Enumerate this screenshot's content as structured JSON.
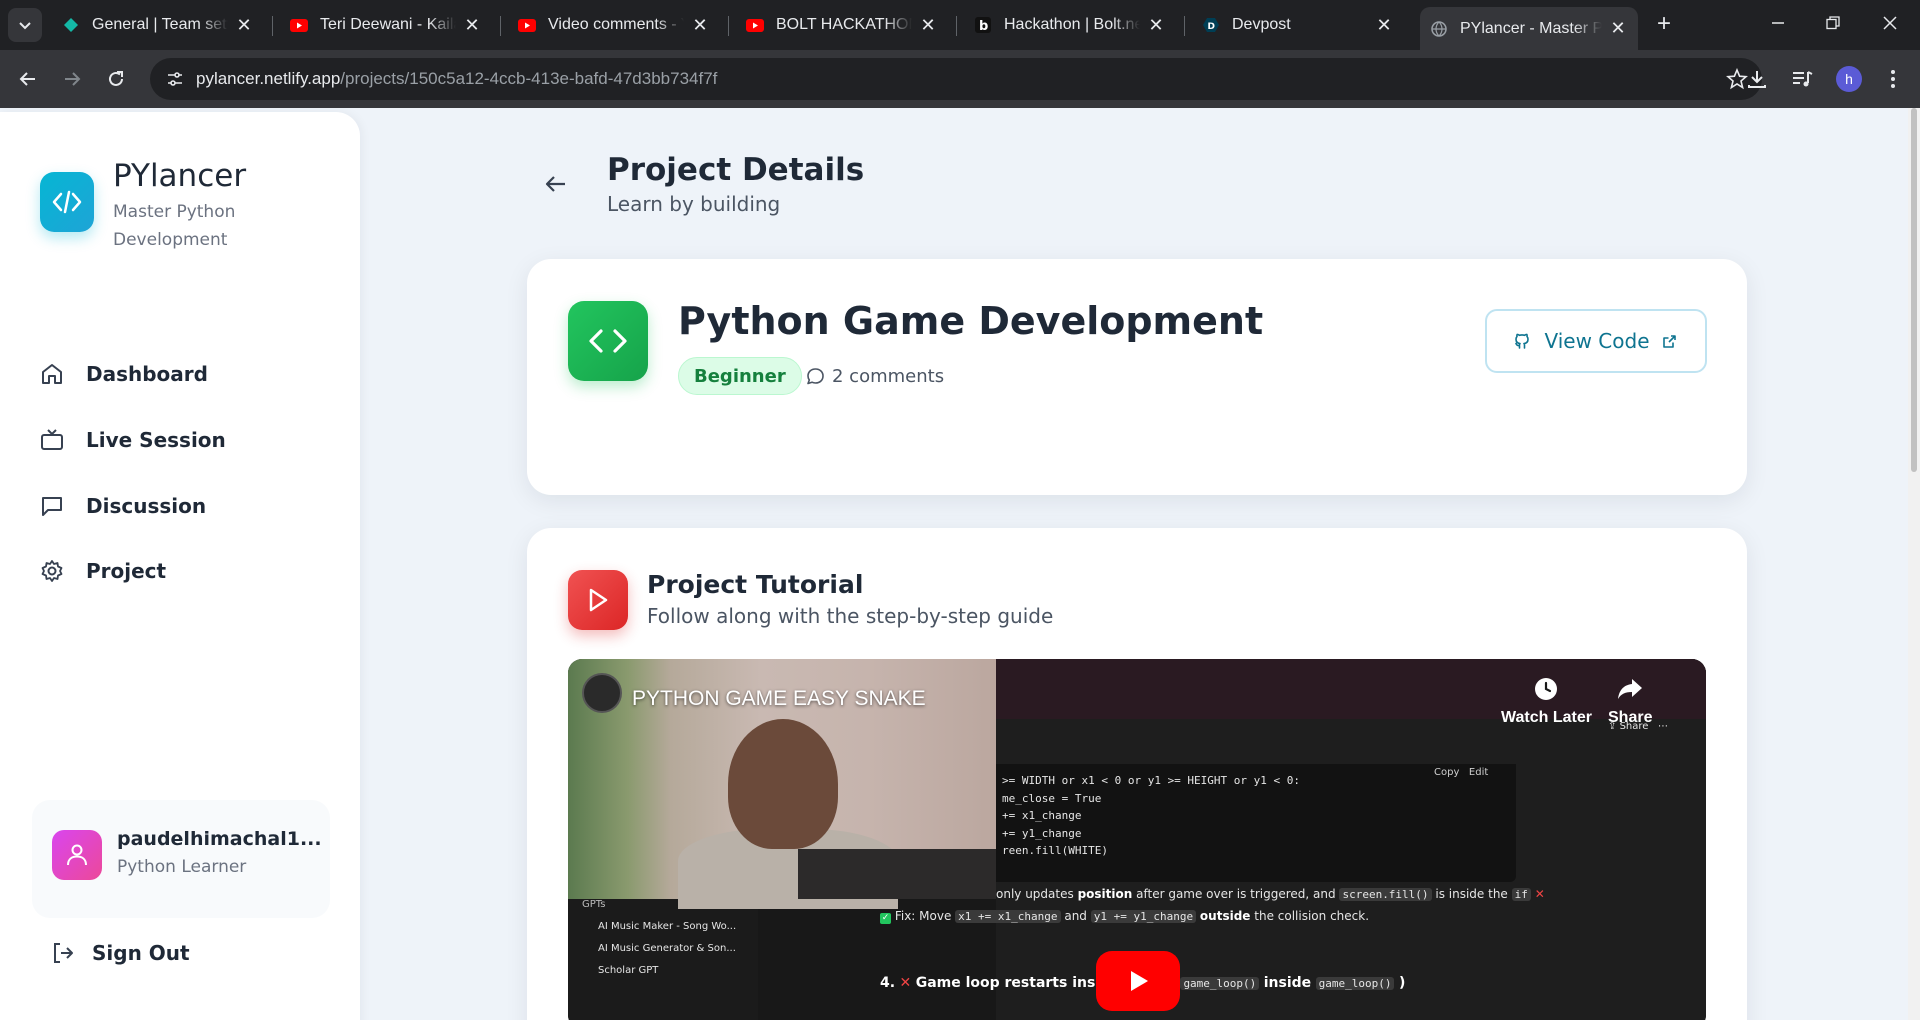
{
  "browser": {
    "tabs": [
      {
        "title": "General | Team settings",
        "icon": "teal-diamond-icon"
      },
      {
        "title": "Teri Deewani - Kailash Kher",
        "icon": "youtube-icon"
      },
      {
        "title": "Video comments - YouTube Studio",
        "icon": "youtube-icon"
      },
      {
        "title": "BOLT HACKATHON PROJECT",
        "icon": "youtube-icon"
      },
      {
        "title": "Hackathon | Bolt.new",
        "icon": "bolt-icon"
      },
      {
        "title": "Devpost",
        "icon": "devpost-icon"
      },
      {
        "title": "PYlancer - Master Python Development",
        "icon": "globe-icon"
      }
    ],
    "url_host": "pylancer.netlify.app",
    "url_path": "/projects/150c5a12-4ccb-413e-bafd-47d3bb734f7f",
    "profile_initial": "h"
  },
  "sidebar": {
    "brand": "PYlancer",
    "tagline": "Master Python Development",
    "nav": [
      {
        "label": "Dashboard",
        "icon": "home-icon"
      },
      {
        "label": "Live Session",
        "icon": "tv-icon"
      },
      {
        "label": "Discussion",
        "icon": "message-icon"
      },
      {
        "label": "Project",
        "icon": "gear-icon"
      }
    ],
    "user": {
      "name": "paudelhimachal1...",
      "role": "Python Learner"
    },
    "sign_out": "Sign Out"
  },
  "header": {
    "title": "Project Details",
    "subtitle": "Learn by building"
  },
  "project": {
    "title": "Python Game Development",
    "level": "Beginner",
    "comments": "2 comments",
    "view_code": "View Code"
  },
  "tutorial": {
    "title": "Project Tutorial",
    "subtitle": "Follow along with the step-by-step guide",
    "video": {
      "title": "PYTHON GAME EASY SNAKE",
      "watch_later": "Watch Later",
      "share": "Share",
      "share_small": "Share",
      "copy": "Copy",
      "edit": "Edit",
      "code_lines": [
        ">= WIDTH or x1 < 0 or y1 >= HEIGHT or y1 < 0:",
        "me_close = True",
        "+= x1_change",
        "+= y1_change",
        "reen.fill(WHITE)"
      ],
      "line_a_1": "only updates",
      "line_a_bold": "position",
      "line_a_2": "after game over is triggered, and",
      "line_a_chip": "screen.fill()",
      "line_a_3": "is inside the",
      "line_a_chip2": "if",
      "line_b_1": "Fix: Move",
      "line_b_chip1": "x1 += x1_change",
      "line_b_2": "and",
      "line_b_chip2": "y1 += y1_change",
      "line_b_bold": "outside",
      "line_b_3": "the collision check.",
      "line_c_1": "4.",
      "line_c_2": "Game loop restarts inside itself (",
      "line_c_chip1": "game_loop()",
      "line_c_3": "inside",
      "line_c_chip2": "game_loop()",
      "line_c_4": ")",
      "gpt_list": [
        "GPTs",
        "AI Music Maker - Song Wo...",
        "AI Music Generator & Son...",
        "Scholar GPT"
      ]
    }
  }
}
